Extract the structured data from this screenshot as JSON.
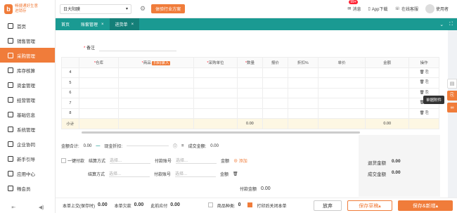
{
  "brand": {
    "name": "畅捷通好生意",
    "sub": "进销存"
  },
  "sidebar": {
    "items": [
      {
        "label": "首页",
        "icon": "home-icon"
      },
      {
        "label": "销售管理",
        "icon": "sales-icon"
      },
      {
        "label": "采购管理",
        "icon": "purchase-icon"
      },
      {
        "label": "库存核算",
        "icon": "inventory-icon"
      },
      {
        "label": "资金管理",
        "icon": "funds-icon"
      },
      {
        "label": "经营管理",
        "icon": "business-icon"
      },
      {
        "label": "基础信息",
        "icon": "info-icon"
      },
      {
        "label": "系统管理",
        "icon": "system-icon"
      },
      {
        "label": "企业协同",
        "icon": "collab-icon"
      },
      {
        "label": "新手引导",
        "icon": "guide-icon"
      },
      {
        "label": "应用中心",
        "icon": "apps-icon"
      },
      {
        "label": "畅会员",
        "icon": "member-icon"
      }
    ]
  },
  "topbar": {
    "company": "日大阳膜",
    "experience_btn": "体验行业方案",
    "messages": "消息",
    "badge": "99+",
    "app": "App下载",
    "online": "在线客服",
    "user": "使用者"
  },
  "tabs": [
    {
      "label": "首页"
    },
    {
      "label": "账套管理"
    },
    {
      "label": "进货单"
    }
  ],
  "note_label": "备注",
  "table": {
    "headers": [
      "",
      "仓库",
      "商品",
      "扫码录入",
      "采购单位",
      "数量",
      "报价",
      "折扣%",
      "单价",
      "金额",
      "操作"
    ],
    "rows": [
      "4",
      "5",
      "6",
      "7",
      "8"
    ],
    "subtotal_label": "小计",
    "subtotal_qty": "0.00",
    "subtotal_amount": "0.00"
  },
  "totals": {
    "sum_label": "金额合计:",
    "sum": "0.00",
    "discount_label": "现金折扣:",
    "deal_label": "成交金额:",
    "deal": "0.00"
  },
  "pay": {
    "one_time": "一键付款",
    "method_label": "结算方式",
    "method_placeholder": "选择...",
    "account_label": "付款账号",
    "account_placeholder": "选择...",
    "amount_label": "金额",
    "add": "添加",
    "paid_label": "付款金额",
    "paid": "0.00"
  },
  "summary": {
    "return_label": "退货金额",
    "return_val": "0.00",
    "deal_label": "成交金额",
    "deal_val": "0.00"
  },
  "tooltip": "单据附件",
  "footer": {
    "prev_label": "本单上交(保存时)",
    "prev": "0.00",
    "this_label": "本单欠款",
    "this": "0.00",
    "due_label": "此前应付",
    "due": "0.00",
    "qty_label": "商品种类:",
    "qty": "0",
    "print_label": "打印后关闭本单",
    "abandon": "放弃",
    "save_draft": "保存草稿",
    "save_new": "保存&新增"
  }
}
